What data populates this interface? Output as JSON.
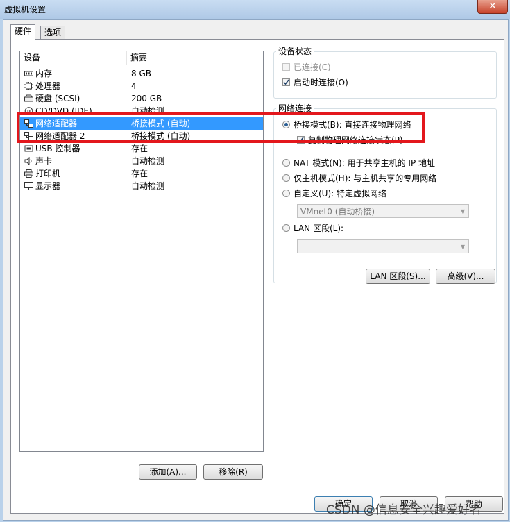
{
  "window": {
    "title": "虚拟机设置",
    "close_glyph": "✕"
  },
  "tabs": [
    {
      "label": "硬件"
    },
    {
      "label": "选项"
    }
  ],
  "device_list": {
    "columns": [
      "设备",
      "摘要"
    ],
    "rows": [
      {
        "name": "内存",
        "summary": "8 GB",
        "icon": "memory-icon"
      },
      {
        "name": "处理器",
        "summary": "4",
        "icon": "cpu-icon"
      },
      {
        "name": "硬盘 (SCSI)",
        "summary": "200 GB",
        "icon": "hard-disk-icon"
      },
      {
        "name": "CD/DVD (IDE)",
        "summary": "自动检测",
        "icon": "cd-dvd-icon"
      },
      {
        "name": "网络适配器",
        "summary": "桥接模式 (自动)",
        "icon": "network-adapter-icon",
        "selected": true
      },
      {
        "name": "网络适配器 2",
        "summary": "桥接模式 (自动)",
        "icon": "network-adapter-icon"
      },
      {
        "name": "USB 控制器",
        "summary": "存在",
        "icon": "usb-controller-icon"
      },
      {
        "name": "声卡",
        "summary": "自动检测",
        "icon": "sound-card-icon"
      },
      {
        "name": "打印机",
        "summary": "存在",
        "icon": "printer-icon"
      },
      {
        "name": "显示器",
        "summary": "自动检测",
        "icon": "display-icon"
      }
    ]
  },
  "list_buttons": {
    "add": "添加(A)...",
    "remove": "移除(R)"
  },
  "device_status": {
    "title": "设备状态",
    "connected": {
      "label": "已连接(C)",
      "checked": false,
      "disabled": true
    },
    "connect_at_power_on": {
      "label": "启动时连接(O)",
      "checked": true
    }
  },
  "network_connection": {
    "title": "网络连接",
    "bridged": {
      "label": "桥接模式(B): 直接连接物理网络",
      "selected": true
    },
    "replicate": {
      "label": "复制物理网络连接状态(P)",
      "checked": true
    },
    "nat": {
      "label": "NAT 模式(N): 用于共享主机的 IP 地址"
    },
    "host_only": {
      "label": "仅主机模式(H): 与主机共享的专用网络"
    },
    "custom": {
      "label": "自定义(U): 特定虚拟网络"
    },
    "custom_combo": {
      "value": "VMnet0 (自动桥接)"
    },
    "lan_segment": {
      "label": "LAN 区段(L):"
    },
    "lan_combo": {
      "value": ""
    }
  },
  "net_buttons": {
    "lan_segments": "LAN 区段(S)...",
    "advanced": "高级(V)..."
  },
  "footer": {
    "ok": "确定",
    "cancel": "取消",
    "help": "帮助"
  },
  "watermark": "CSDN @信息安全兴趣爱好者",
  "colors": {
    "selection": "#3399ff",
    "highlight_box": "#e3171c"
  }
}
